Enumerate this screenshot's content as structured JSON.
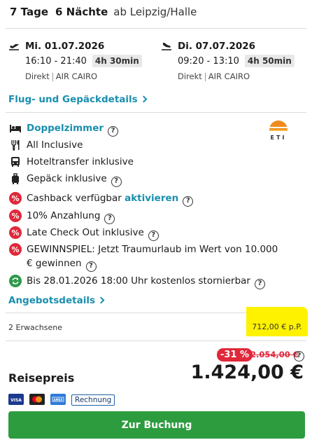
{
  "header": {
    "days": "7 Tage",
    "nights": "6 Nächte",
    "departure": "ab Leipzig/Halle"
  },
  "outbound": {
    "date": "Mi. 01.07.2026",
    "times": "16:10 - 21:40",
    "duration": "4h 30min",
    "type": "Direkt",
    "airline": "AIR CAIRO",
    "icon": "plane-takeoff-icon"
  },
  "return": {
    "date": "Di. 07.07.2026",
    "times": "09:20 - 13:10",
    "duration": "4h 50min",
    "type": "Direkt",
    "airline": "AIR CAIRO",
    "icon": "plane-landing-icon"
  },
  "flight_details_link": "Flug- und Gepäckdetails",
  "room": "Doppelzimmer",
  "features": {
    "board": "All Inclusive",
    "transfer": "Hoteltransfer inklusive",
    "baggage": "Gepäck inklusive",
    "cashback": "Cashback verfügbar",
    "cashback_action": "aktivieren",
    "deposit": "10% Anzahlung",
    "checkout": "Late Check Out inklusive",
    "contest": "GEWINNSPIEL: Jetzt Traumurlaub im Wert von 10.000 € gewinnen",
    "cancellation": "Bis 28.01.2026 18:00 Uhr kostenlos stornierbar"
  },
  "operator_logo_text": "ETI",
  "offer_details_link": "Angebotsdetails",
  "travellers": "2 Erwachsene",
  "price_per_person": "712,00 € p.P.",
  "discount": "-31 %",
  "old_price": "2.054,00 €",
  "price_label": "Reisepreis",
  "total_price": "1.424,00 €",
  "payment_methods": [
    "VISA",
    "Mastercard",
    "AMEX",
    "Rechnung"
  ],
  "book_button": "Zur Buchung",
  "colors": {
    "accent": "#1a8fae",
    "discount": "#e0283a",
    "book": "#2d9c3f",
    "highlight": "#fff200"
  }
}
